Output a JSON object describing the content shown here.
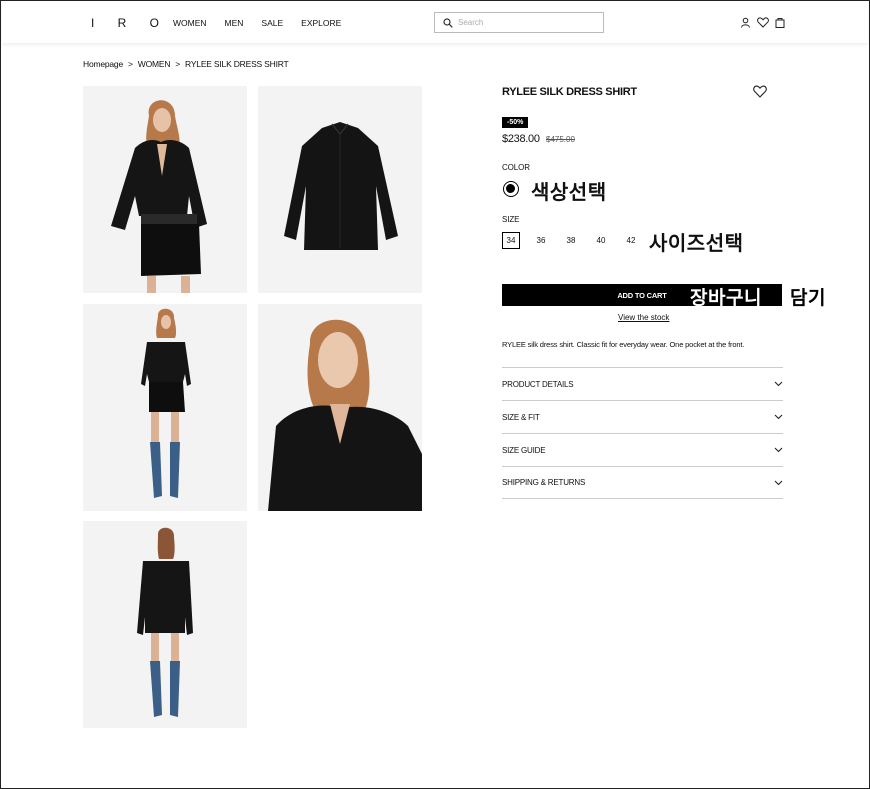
{
  "header": {
    "logo": "I R O",
    "nav": [
      "WOMEN",
      "MEN",
      "SALE",
      "EXPLORE"
    ],
    "search_placeholder": "Search",
    "icons": [
      "user-icon",
      "heart-icon",
      "bag-icon"
    ]
  },
  "breadcrumb": [
    "Homepage",
    "WOMEN",
    "RYLEE SILK DRESS SHIRT"
  ],
  "breadcrumb_sep": ">",
  "product": {
    "title": "RYLEE SILK DRESS SHIRT",
    "discount": "-50%",
    "price": "$238.00",
    "old_price": "$475.00",
    "color_label": "COLOR",
    "color_annotation": "색상선택",
    "size_label": "SIZE",
    "sizes": [
      "34",
      "36",
      "38",
      "40",
      "42"
    ],
    "selected_size": "34",
    "size_annotation": "사이즈선택",
    "add_to_cart": "ADD TO CART",
    "cart_annotation_1": "장바구니",
    "cart_annotation_2": "담기",
    "view_stock": "View the stock",
    "description": "RYLEE silk dress shirt. Classic fit for everyday wear. One pocket at the front.",
    "accordions": [
      "PRODUCT DETAILS",
      "SIZE & FIT",
      "SIZE GUIDE",
      "SHIPPING & RETURNS"
    ]
  },
  "colors": {
    "accent": "#000000",
    "image_bg": "#f3f3f3",
    "boots": "#3b5f86"
  }
}
